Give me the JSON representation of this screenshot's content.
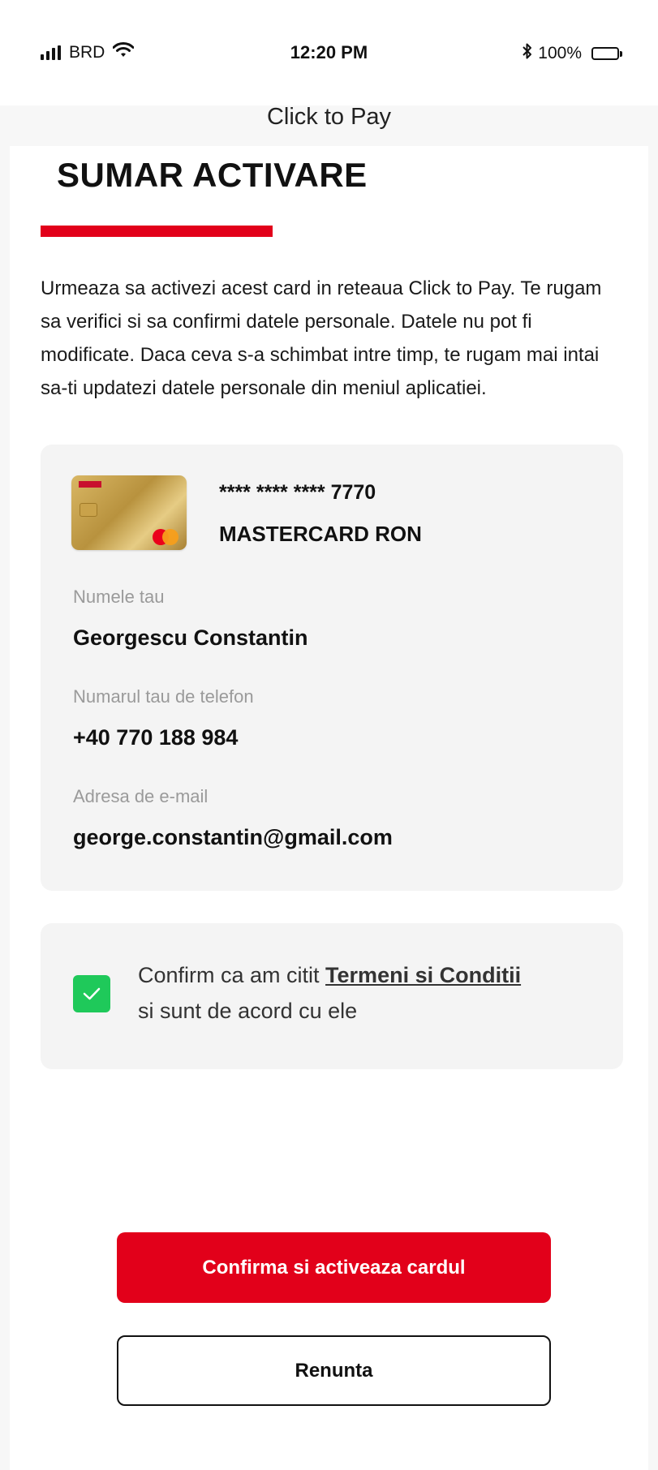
{
  "status_bar": {
    "carrier": "BRD",
    "time": "12:20 PM",
    "battery": "100%"
  },
  "header": {
    "title": "Click to Pay"
  },
  "main": {
    "title": "SUMAR ACTIVARE",
    "intro": "Urmeaza sa activezi acest card in reteaua Click to Pay. Te rugam sa verifici si sa confirmi datele personale. Datele nu pot fi modificate. Daca ceva s-a schimbat intre timp, te rugam mai intai sa-ti updatezi datele personale din meniul aplicatiei."
  },
  "card": {
    "masked_number": "**** **** **** 7770",
    "type": "MASTERCARD RON",
    "image_icon": "card-image-icon"
  },
  "fields": {
    "name_label": "Numele tau",
    "name_value": "Georgescu Constantin",
    "phone_label": "Numarul tau de telefon",
    "phone_value": "+40 770 188 984",
    "email_label": "Adresa de e-mail",
    "email_value": "george.constantin@gmail.com"
  },
  "consent": {
    "text_before": "Confirm ca am citit ",
    "link": "Termeni si Conditii",
    "text_after": "si sunt de acord cu ele",
    "checked": true
  },
  "buttons": {
    "confirm": "Confirma si activeaza cardul",
    "cancel": "Renunta"
  },
  "colors": {
    "brand_red": "#e2001a",
    "checkbox_green": "#1fc95a"
  }
}
